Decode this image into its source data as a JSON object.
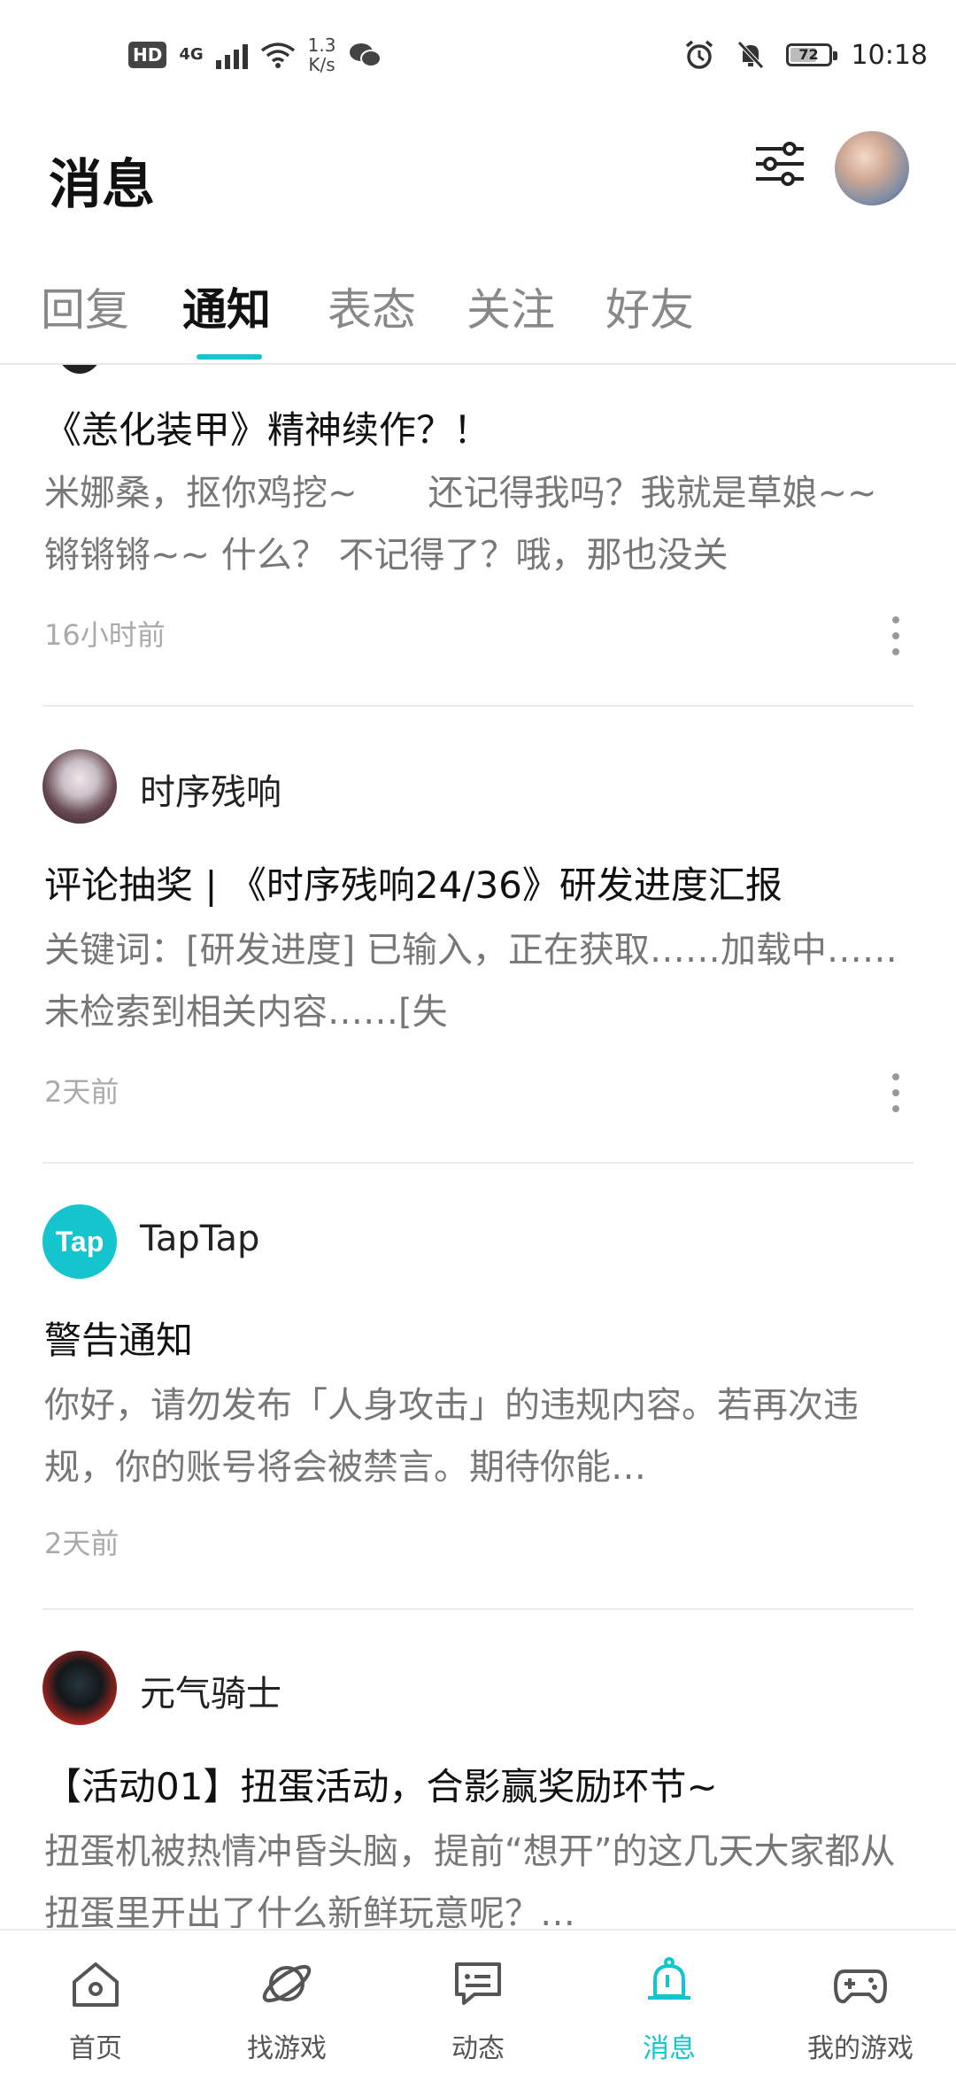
{
  "status_bar": {
    "hd": "HD",
    "network": "4G",
    "speed_value": "1.3",
    "speed_unit": "K/s",
    "battery": "72",
    "battery_level": 0.72,
    "time": "10:18"
  },
  "header": {
    "title": "消息"
  },
  "tabs": [
    {
      "label": "回复",
      "active": false
    },
    {
      "label": "通知",
      "active": true
    },
    {
      "label": "表态",
      "active": false
    },
    {
      "label": "关注",
      "active": false
    },
    {
      "label": "好友",
      "active": false
    }
  ],
  "notifications": [
    {
      "sender": "",
      "title": "《恙化装甲》精神续作？！",
      "body": "米娜桑，抠你鸡挖~　　还记得我吗？我就是草娘~~ 锵锵锵~~ 什么？ 不记得了？哦，那也没关",
      "time": "16小时前"
    },
    {
      "sender": "时序残响",
      "title": "评论抽奖 | 《时序残响24/36》研发进度汇报",
      "body": "关键词：[研发进度] 已输入，正在获取……加载中……未检索到相关内容……[失",
      "time": "2天前"
    },
    {
      "sender": "TapTap",
      "avatar_text": "Tap",
      "title": "警告通知",
      "body": "你好，请勿发布「人身攻击」的违规内容。若再次违规，你的账号将会被禁言。期待你能…",
      "time": "2天前"
    },
    {
      "sender": "元气骑士",
      "title": "【活动01】扭蛋活动，合影赢奖励环节~",
      "body": "扭蛋机被热情冲昏头脑，提前“想开”的这几天大家都从扭蛋里开出了什么新鲜玩意呢？…"
    }
  ],
  "bottom_nav": [
    {
      "label": "首页",
      "icon": "home-icon"
    },
    {
      "label": "找游戏",
      "icon": "planet-icon"
    },
    {
      "label": "动态",
      "icon": "chat-bubble-icon"
    },
    {
      "label": "消息",
      "icon": "bell-icon",
      "active": true
    },
    {
      "label": "我的游戏",
      "icon": "gamepad-icon"
    }
  ],
  "colors": {
    "accent": "#15c5ce",
    "text_primary": "#111111",
    "text_secondary": "#777777",
    "text_muted": "#aaaaaa"
  }
}
